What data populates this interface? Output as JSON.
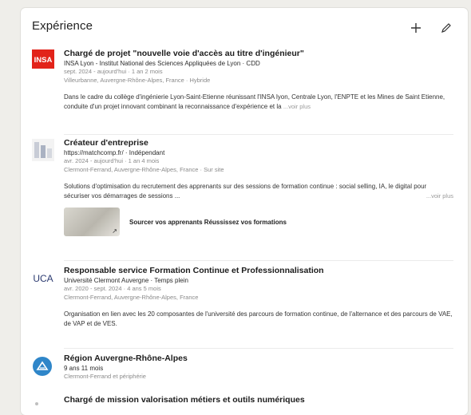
{
  "section": {
    "title": "Expérience",
    "add_icon": "plus-icon",
    "edit_icon": "pencil-icon"
  },
  "experiences": [
    {
      "role": "Chargé de projet \"nouvelle voie d'accès au titre d'ingénieur\"",
      "org": "INSA Lyon - Institut National des Sciences Appliquées de Lyon · CDD",
      "dates": "sept. 2024 - aujourd'hui · 1 an 2 mois",
      "location": "Villeurbanne, Auvergne-Rhône-Alpes, France · Hybride",
      "desc": "Dans le cadre du collège d'ingénierie Lyon-Saint-Etienne réunissant l'INSA lyon, Centrale Lyon, l'ENPTE et les Mines de Saint Etienne, conduite d'un projet innovant combinant la reconnaissance d'expérience et la",
      "more": "...voir plus",
      "logo_text": "INSA",
      "logo_color": "#e2231a"
    },
    {
      "role": "Créateur d'entreprise",
      "org": "https://matchcomp.fr/ · Indépendant",
      "dates": "avr. 2024 - aujourd'hui · 1 an 4 mois",
      "location": "Clermont-Ferrand, Auvergne-Rhône-Alpes, France · Sur site",
      "desc": "Solutions d'optimisation du recrutement des apprenants sur des sessions de formation continue : social selling, IA, le digital pour sécuriser vos démarrages de sessions ...",
      "more": "...voir plus",
      "media_label": "Sourcer vos apprenants Réussissez vos formations",
      "media_icon": "external-link-icon"
    },
    {
      "role": "Responsable service Formation Continue et Professionnalisation",
      "org": "Université Clermont Auvergne · Temps plein",
      "dates": "avr. 2020 - sept. 2024 · 4 ans 5 mois",
      "location": "Clermont-Ferrand, Auvergne-Rhône-Alpes, France",
      "desc": "Organisation en lien avec les 20 composantes de l'université des parcours de formation continue, de l'alternance et des parcours de VAE, de VAP et de VES.",
      "logo_text": "UCA",
      "logo_color": "#2b3a70"
    },
    {
      "role": "Région Auvergne-Rhône-Alpes",
      "org": "9 ans 11 mois",
      "location": "Clermont-Ferrand et périphérie",
      "logo_color": "#2f86c9"
    },
    {
      "role": "Chargé de mission valorisation métiers et outils numériques"
    }
  ]
}
